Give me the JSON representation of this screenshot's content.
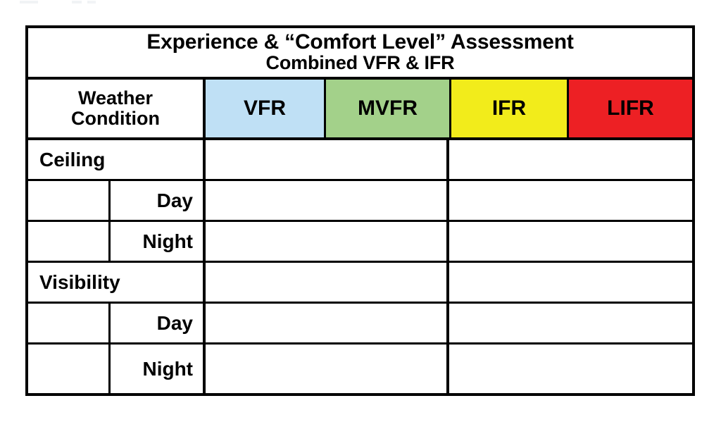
{
  "document": {
    "title_line_1": "Experience & “Comfort Level” Assessment",
    "title_line_2": "Combined VFR & IFR"
  },
  "table": {
    "header": {
      "weather_condition_line_1": "Weather",
      "weather_condition_line_2": "Condition",
      "categories": [
        {
          "label": "VFR",
          "color": "#BFE0F5"
        },
        {
          "label": "MVFR",
          "color": "#A3D18A"
        },
        {
          "label": "IFR",
          "color": "#F2EC1B"
        },
        {
          "label": "LIFR",
          "color": "#ED2024"
        }
      ]
    },
    "rows": [
      {
        "kind": "section",
        "label": "Ceiling",
        "sub_label": "",
        "left_value": "",
        "right_value": ""
      },
      {
        "kind": "sub",
        "label": "",
        "sub_label": "Day",
        "left_value": "",
        "right_value": ""
      },
      {
        "kind": "sub",
        "label": "",
        "sub_label": "Night",
        "left_value": "",
        "right_value": ""
      },
      {
        "kind": "section",
        "label": "Visibility",
        "sub_label": "",
        "left_value": "",
        "right_value": ""
      },
      {
        "kind": "sub",
        "label": "",
        "sub_label": "Day",
        "left_value": "",
        "right_value": ""
      },
      {
        "kind": "sub",
        "label": "",
        "sub_label": "Night",
        "left_value": "",
        "right_value": ""
      }
    ]
  },
  "style": {
    "border_color": "#000000",
    "background": "#FFFFFF",
    "text_color": "#000000"
  }
}
